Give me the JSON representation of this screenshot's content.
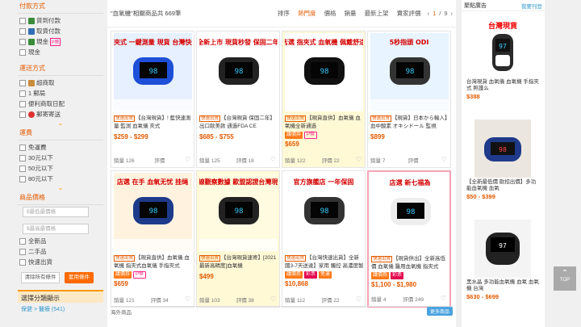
{
  "sidebar": {
    "payment_title": "付款方式",
    "payment_items": [
      {
        "label": "貨到付款",
        "icon": "cash-icon",
        "color": "#3a8c3a"
      },
      {
        "label": "取貨付款",
        "icon": "store-icon",
        "color": "#2f6fb5"
      },
      {
        "label": "現金",
        "icon": "cash-icon",
        "color": "#3a8c3a"
      },
      {
        "label": "現金"
      }
    ],
    "payment_extra": "P幣",
    "shipping_title": "運送方式",
    "shipping_items": [
      {
        "label": "超商取",
        "icon": "box-icon",
        "color": "#c98b3c"
      },
      {
        "label": "1 郵局"
      },
      {
        "label": "便利商取日配"
      },
      {
        "label": "郵寄寄送",
        "icon": "post-icon",
        "color": "#d33"
      }
    ],
    "fee_title": "運費",
    "fee_items": [
      "免運費",
      "30元以下",
      "50元以下",
      "80元以下"
    ],
    "cond_title": "商品價格",
    "price_min_placeholder": "$最低最價格",
    "price_max_placeholder": "$最高最價格",
    "cond_items": [
      "全新品",
      "二手品",
      "快速出貨"
    ],
    "clear_label": "清除所有條件",
    "apply_label": "套用條件",
    "cat_title": "選擇分類顯示",
    "cat_sub": "保健 > 醫療 (541)"
  },
  "toolbar": {
    "result_text": "\"血氧機\"相關商品共 669筆",
    "sort_label": "排序",
    "sort_options": [
      "熱門度",
      "價格",
      "銷量",
      "最新上架",
      "賣家評價"
    ],
    "page_current": "1",
    "page_sep": "/",
    "page_total": "9"
  },
  "products": [
    {
      "tag": "快速出貨",
      "name": "【台灣現貨】! 藍快速測量 監測 血氧儀 夾式",
      "price": "$259 - $299",
      "sold": "126",
      "rating": "",
      "thumb_text": "TFT指夾式 一鍵測量 現貨 台灣快速出貨",
      "thumb_bg": "#e6f0ff",
      "badges": [],
      "hl": false,
      "pink": false
    },
    {
      "tag": "快速出貨",
      "name": "【台灣現貨 保固二年】出口歐美款 通過FDA CE",
      "price": "$685 - $755",
      "sold": "125",
      "rating": "18",
      "thumb_text": "全新上市 現貨秒發 保固二年",
      "thumb_bg": "#ffffff",
      "badges": [],
      "hl": false,
      "pink": false
    },
    {
      "tag": "快速出貨",
      "name": "【現貨直供】血氧儀 血氧機全新通過",
      "price": "$659",
      "sold": "122",
      "rating": "22",
      "thumb_text": "店選 指夾式 血氧機 佩戴舒适",
      "thumb_bg": "#ffffff",
      "badges": [
        {
          "t": "議價券",
          "c": "o"
        },
        {
          "t": "P幣",
          "c": "p"
        }
      ],
      "hl": true,
      "pink": false
    },
    {
      "tag": "快速出貨",
      "name": "【現貨】日本から輸入】血中酸素 オキシドール 監視",
      "price": "$899",
      "sold": "7",
      "rating": "",
      "thumb_text": "5秒指頭 ODI",
      "thumb_bg": "#e8f4ff",
      "badges": [],
      "hl": false,
      "pink": false
    },
    {
      "tag": "快速出貨",
      "name": "【現貨直供】血氧儀 血氧機 指夾式血氧儀 手指夾式",
      "price": "$659",
      "sold": "121",
      "rating": "34",
      "thumb_text": "店選 在手 血氧无忧 挂绳",
      "thumb_bg": "#fff3e0",
      "badges": [
        {
          "t": "議價券",
          "c": "o"
        },
        {
          "t": "P幣",
          "c": "p"
        }
      ],
      "hl": false,
      "pink": false
    },
    {
      "tag": "快速出貨",
      "name": "【台灣現貨速寄】[2021最新高精度]血氧機",
      "price": "$499",
      "sold": "103",
      "rating": "38",
      "thumb_text": "曲線觀察數據 歐盟認證台灣現貨",
      "thumb_bg": "#fffbe0",
      "badges": [],
      "hl": true,
      "pink": false
    },
    {
      "tag": "快速出貨",
      "name": "【台灣快速出貨】全新國3-7天送達】家用 觸控 高濃度製氧機",
      "price": "$10,868",
      "sold": "112",
      "rating": "22",
      "thumb_text": "官方旗艦店 一年保固",
      "thumb_bg": "#ffffff",
      "badges": [
        {
          "t": "議價券",
          "c": "o"
        },
        {
          "t": "彩票",
          "c": "r"
        },
        {
          "t": "免運",
          "c": "o"
        }
      ],
      "hl": false,
      "pink": false
    },
    {
      "tag": "快速出貨",
      "name": "【現貨供出】全新高低價 血氧儀 醫用血氧機 指夾式 YX101",
      "price": "$1,100 - $1,980",
      "sold": "4",
      "rating": "249",
      "thumb_text": "店選 新七福為",
      "thumb_bg": "#ffffff",
      "badges": [
        {
          "t": "議價券",
          "c": "o"
        },
        {
          "t": "彩票",
          "c": "r"
        }
      ],
      "hl": false,
      "pink": true
    }
  ],
  "page_footer": {
    "left": "海外商品",
    "more": "更多商品"
  },
  "ads": {
    "title": "聚點廣告",
    "link": "我要刊登",
    "items": [
      {
        "name": "台灣現貨 血氧儀 血氧機 手指夾式 照護么",
        "price": "$388",
        "img_text": "台灣現貨",
        "bg": "#ffffff"
      },
      {
        "name": "【全新最低價 歐招出價】多功能血氧機 血氧",
        "price": "$50 - $399",
        "img_text": "",
        "bg": "#ece6e0"
      },
      {
        "name": "黑水晶 多功能血氧機 血氧 血氧機 台灣",
        "price": "$630 - $699",
        "img_text": "",
        "bg": "#f4f4f4"
      }
    ]
  },
  "top_button": "TOP"
}
